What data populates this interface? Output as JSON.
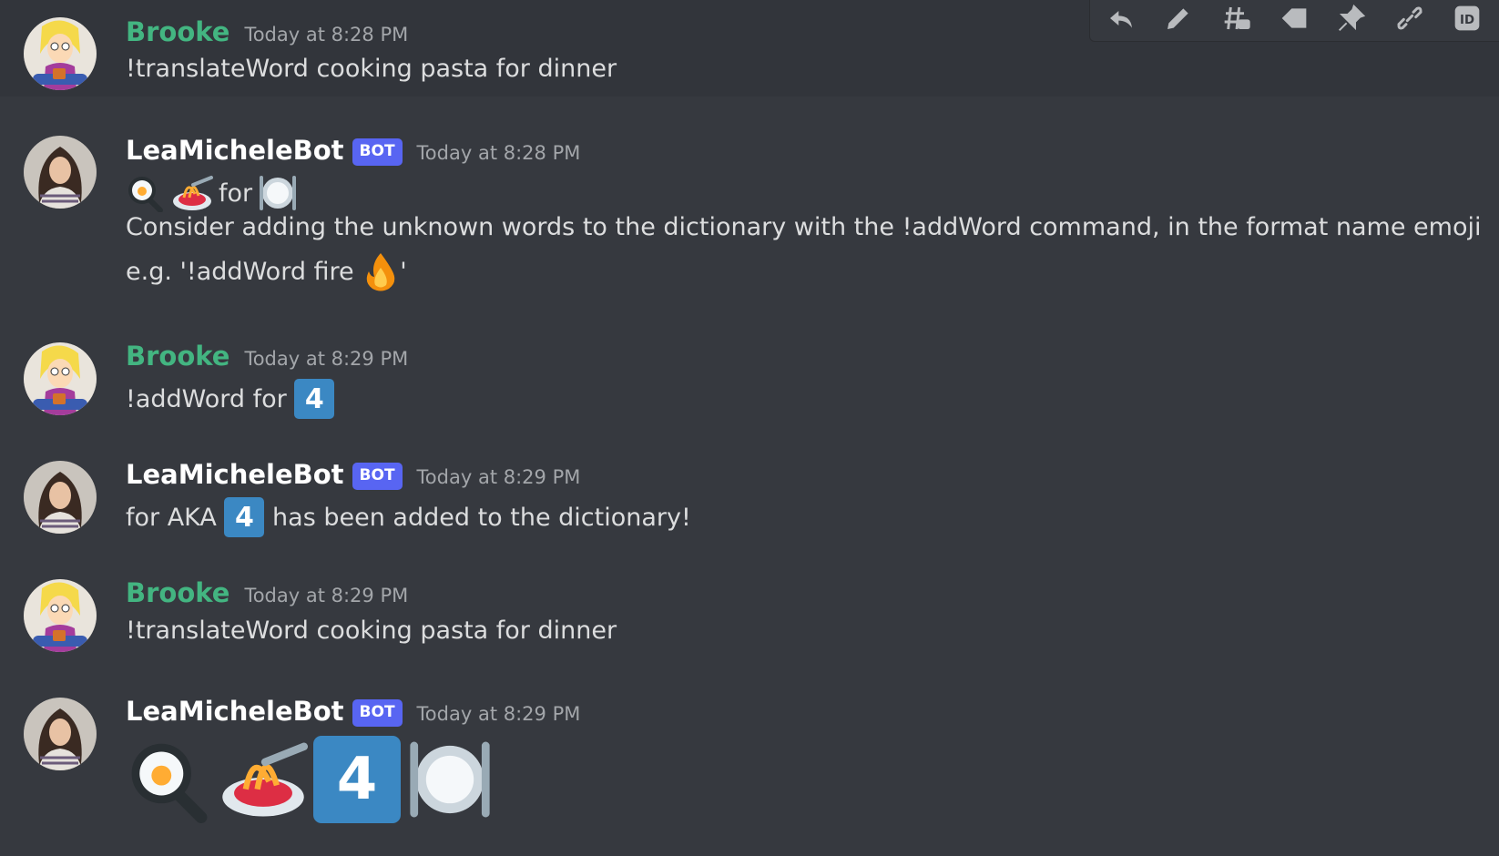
{
  "toolbar": {
    "icons": [
      "reply-icon",
      "edit-icon",
      "thread-icon",
      "tag-icon",
      "pin-icon",
      "link-icon",
      "copy-id-icon"
    ],
    "id_label": "ID"
  },
  "messages": [
    {
      "author": "Brooke",
      "timestamp": "Today at 8:28 PM",
      "text": "!translateWord cooking pasta for dinner"
    },
    {
      "author": "LeaMicheleBot",
      "bot_tag": "BOT",
      "timestamp": "Today at 8:28 PM",
      "emoji_line_word": "for",
      "text_line1": "Consider adding the unknown words to the dictionary with the !addWord command, in the format name emoji",
      "text_line2_before": "e.g. '!addWord fire ",
      "text_line2_after": "'"
    },
    {
      "author": "Brooke",
      "timestamp": "Today at 8:29 PM",
      "text": "!addWord for ",
      "keycap": "4"
    },
    {
      "author": "LeaMicheleBot",
      "bot_tag": "BOT",
      "timestamp": "Today at 8:29 PM",
      "text_before": "for AKA ",
      "keycap": "4",
      "text_after": " has been added to the dictionary!"
    },
    {
      "author": "Brooke",
      "timestamp": "Today at 8:29 PM",
      "text": "!translateWord cooking pasta for dinner"
    },
    {
      "author": "LeaMicheleBot",
      "bot_tag": "BOT",
      "timestamp": "Today at 8:29 PM",
      "keycap": "4"
    }
  ],
  "colors": {
    "background": "#36393f",
    "user_name": "#43b581",
    "bot_tag": "#5865f2",
    "keycap": "#3b88c3"
  }
}
